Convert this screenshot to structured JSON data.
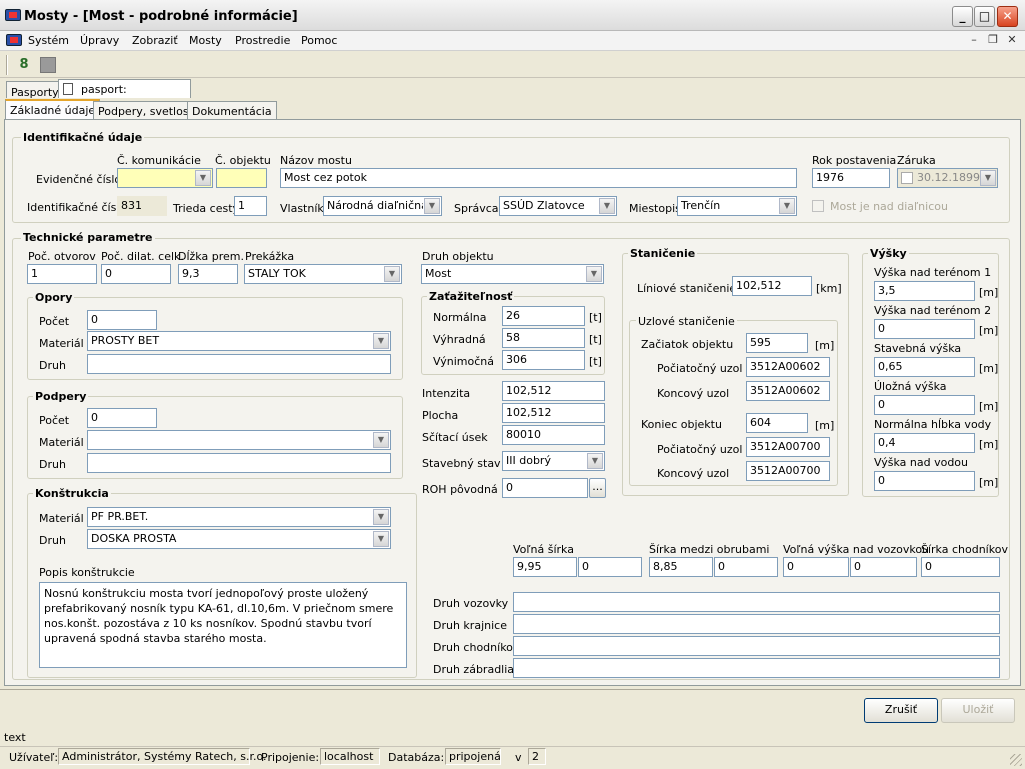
{
  "window": {
    "title": "Mosty - [Most - podrobné informácie]",
    "icon": "app-bridge-icon"
  },
  "menu": {
    "items": [
      "Systém",
      "Úpravy",
      "Zobraziť",
      "Mosty",
      "Prostredie",
      "Pomoc"
    ]
  },
  "doc_tabs": {
    "pasporty": "Pasporty",
    "pasport": "pasport:"
  },
  "tabs": [
    "Základné údaje",
    "Podpery, svetlosť",
    "Dokumentácia"
  ],
  "ident": {
    "title": "Identifikačné údaje",
    "lbl_kom": "Č. komunikácie",
    "lbl_obj": "Č. objektu",
    "lbl_nazov": "Názov mostu",
    "lbl_rok": "Rok postavenia",
    "lbl_zaruka": "Záruka",
    "lbl_evid": "Evidenčné číslo",
    "nazov": "Most cez potok",
    "rok": "1976",
    "zaruka": "30.12.1899",
    "lbl_idc": "Identifikačné číslo",
    "idc": "831",
    "lbl_trieda": "Trieda cesty",
    "trieda": "1",
    "lbl_vlastnik": "Vlastník",
    "vlastnik": "Národná diaľničná s",
    "lbl_spravca": "Správca",
    "spravca": "SSÚD Zlatovce",
    "lbl_miestopis": "Miestopis",
    "miestopis": "Trenčín",
    "lbl_nad_dialnicou": "Most je nad diaľnicou"
  },
  "tech": {
    "title": "Technické parametre",
    "lbl_otvorov": "Poč. otvorov",
    "otvorov": "1",
    "lbl_dilat": "Poč. dilat. celk.",
    "dilat": "0",
    "lbl_dlzka": "Dĺžka prem.",
    "dlzka": "9,3",
    "lbl_prekazka": "Prekážka",
    "prekazka": "STALY TOK",
    "lbl_druh_obj": "Druh objektu",
    "druh_obj": "Most"
  },
  "opory": {
    "title": "Opory",
    "lbl_pocet": "Počet",
    "pocet": "0",
    "lbl_material": "Materiál",
    "material": "PROSTY BET",
    "lbl_druh": "Druh",
    "druh": ""
  },
  "podpery": {
    "title": "Podpery",
    "lbl_pocet": "Počet",
    "pocet": "0",
    "lbl_material": "Materiál",
    "material": "",
    "lbl_druh": "Druh",
    "druh": ""
  },
  "konstrukcia": {
    "title": "Konštrukcia",
    "lbl_material": "Materiál",
    "material": "PF PR.BET.",
    "lbl_druh": "Druh",
    "druh": "DOSKA PROSTA",
    "lbl_popis": "Popis konštrukcie",
    "popis": "Nosnú konštrukciu mosta tvorí jednopoľový proste uložený\nprefabrikovaný nosník typu KA-61, dl.10,6m. V priečnom smere\nnos.konšt. pozostáva z 10 ks nosníkov. Spodnú stavbu tvorí\nupravená spodná stavba starého mosta."
  },
  "zatazitelnost": {
    "title": "Zaťažiteľnosť",
    "lbl_norm": "Normálna",
    "norm": "26",
    "lbl_vyhr": "Výhradná",
    "vyhr": "58",
    "lbl_vynim": "Výnimočná",
    "vynim": "306",
    "unit": "[t]"
  },
  "misc": {
    "lbl_intenzita": "Intenzita",
    "intenzita": "102,512",
    "lbl_plocha": "Plocha",
    "plocha": "102,512",
    "lbl_scitaci": "Sčítací úsek",
    "scitaci": "80010",
    "lbl_stav": "Stavebný stav",
    "stav": "III   dobrý",
    "lbl_roh": "ROH pôvodná",
    "roh": "0",
    "roh_btn": "..."
  },
  "stanicenie": {
    "title": "Staničenie",
    "lbl_linio": "Líniové staničenie",
    "linio": "102,512",
    "linio_unit": "[km]",
    "uzlove_title": "Uzlové staničenie",
    "lbl_zaciatok": "Začiatok objektu",
    "zaciatok": "595",
    "lbl_poc1": "Počiatočný uzol",
    "poc1": "3512A00602",
    "lbl_kon1": "Koncový uzol",
    "kon1": "3512A00602",
    "lbl_koniec": "Koniec objektu",
    "koniec": "604",
    "lbl_poc2": "Počiatočný uzol",
    "poc2": "3512A00700",
    "lbl_kon2": "Koncový uzol",
    "kon2": "3512A00700",
    "unit_m": "[m]"
  },
  "vysky": {
    "title": "Výšky",
    "items": [
      {
        "label": "Výška nad terénom 1",
        "value": "3,5"
      },
      {
        "label": "Výška nad terénom 2",
        "value": "0"
      },
      {
        "label": "Stavebná výška",
        "value": "0,65"
      },
      {
        "label": "Úložná výška",
        "value": "0"
      },
      {
        "label": "Normálna hĺbka vody",
        "value": "0,4"
      },
      {
        "label": "Výška nad vodou",
        "value": "0"
      }
    ],
    "unit": "[m]"
  },
  "sirky": {
    "lbl_volna": "Voľná šírka",
    "volna1": "9,95",
    "volna2": "0",
    "lbl_obrub": "Šírka medzi obrubami",
    "obrub1": "8,85",
    "obrub2": "0",
    "lbl_vvyska": "Voľná výška nad vozovkou",
    "vvyska1": "0",
    "vvyska2": "0",
    "lbl_chodnik": "Šírka chodníkov",
    "chodnik": "0"
  },
  "druhy": {
    "lbl_vozovky": "Druh vozovky",
    "lbl_krajnice": "Druh krajnice",
    "lbl_chodnikov": "Druh chodníkov",
    "lbl_zabradlia": "Druh zábradlia"
  },
  "buttons": {
    "cancel": "Zrušiť",
    "save": "Uložiť"
  },
  "statusbar": {
    "text": "text",
    "lbl_user": "Užívateľ:",
    "user": "Administrátor, Systémy Ratech, s.r.o.",
    "lbl_conn": "Pripojenie:",
    "conn": "localhost",
    "lbl_db": "Databáza:",
    "db": "pripojená",
    "lbl_v": "v",
    "v": "2"
  }
}
